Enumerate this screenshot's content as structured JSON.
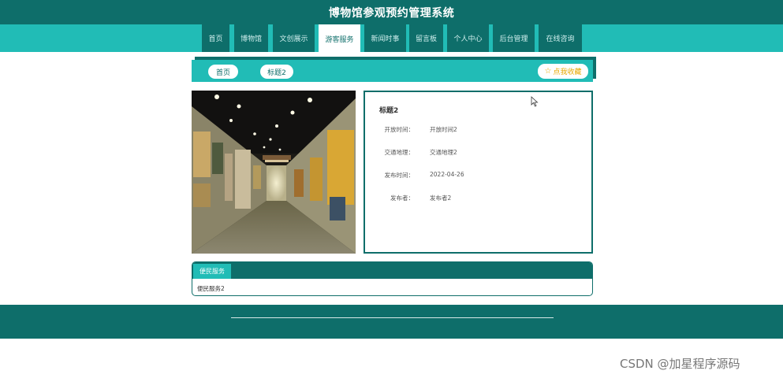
{
  "header": {
    "title": "博物馆参观预约管理系统"
  },
  "nav": {
    "items": [
      {
        "label": "首页"
      },
      {
        "label": "博物馆"
      },
      {
        "label": "文创展示"
      },
      {
        "label": "游客服务"
      },
      {
        "label": "新闻时事"
      },
      {
        "label": "留言板"
      },
      {
        "label": "个人中心"
      },
      {
        "label": "后台管理"
      },
      {
        "label": "在线咨询"
      }
    ],
    "active": "游客服务"
  },
  "breadcrumb": {
    "home": "首页",
    "current": "标题2",
    "favorite": "点我收藏"
  },
  "detail": {
    "title": "标题2",
    "fields": [
      {
        "label": "开放时间：",
        "value": "开放时间2"
      },
      {
        "label": "交通地理：",
        "value": "交通地理2"
      },
      {
        "label": "发布时间：",
        "value": "2022-04-26"
      },
      {
        "label": "发布者：",
        "value": "发布者2"
      }
    ]
  },
  "service": {
    "tab": "便民服务",
    "content": "便民服务2"
  },
  "colors": {
    "dark_teal": "#0e6e6a",
    "light_teal": "#21bcb6",
    "favorite_gold": "#e8a800"
  },
  "watermark": "CSDN @加星程序源码"
}
